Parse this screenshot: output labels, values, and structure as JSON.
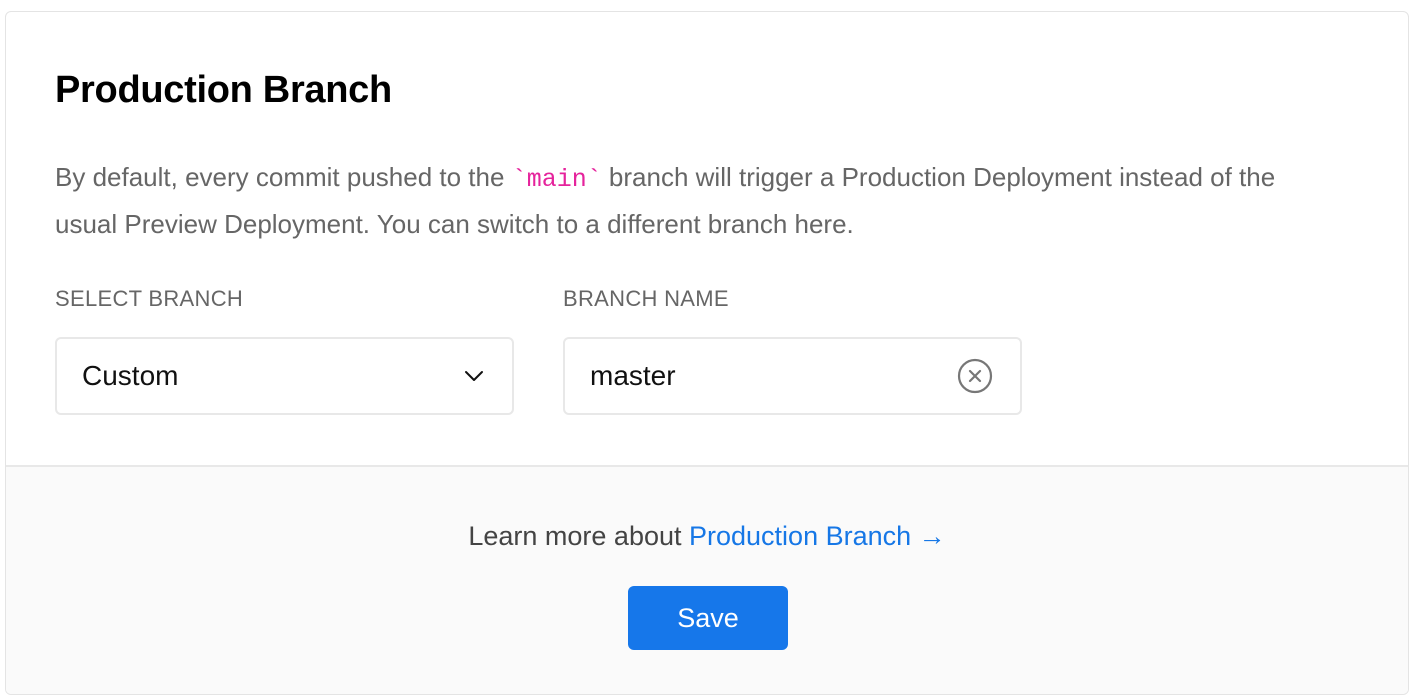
{
  "card": {
    "title": "Production Branch",
    "description": {
      "part1": "By default, every commit pushed to the ",
      "code": "`main`",
      "part2": " branch will trigger a Production Deployment instead of the usual Preview Deployment. You can switch to a different branch here."
    }
  },
  "form": {
    "select_label": "SELECT BRANCH",
    "select_value": "Custom",
    "name_label": "BRANCH NAME",
    "name_value": "master"
  },
  "footer": {
    "learn_prefix": "Learn more about ",
    "learn_link": "Production Branch →",
    "save_label": "Save"
  },
  "colors": {
    "accent": "#1677ea",
    "link": "#1677e6",
    "code": "#e5239c",
    "muted_text": "#666666",
    "footer_bg": "#fafafa"
  },
  "icons": {
    "select": "chevron-down-icon",
    "clear": "clear-circle-x-icon"
  }
}
